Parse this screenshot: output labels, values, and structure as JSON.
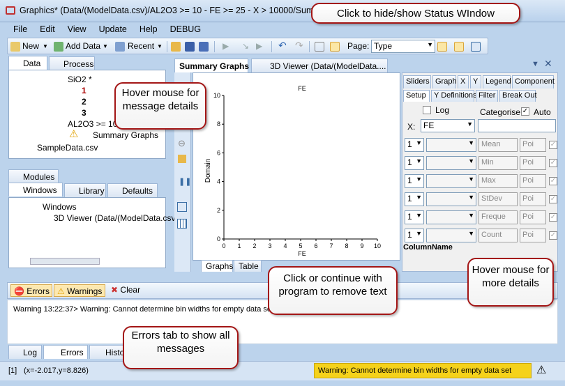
{
  "window": {
    "title": "Graphics* (Data/(ModelData.csv)/AL2O3 >= 10 - FE >= 25 - X > 10000/Summary"
  },
  "menu": [
    "File",
    "Edit",
    "View",
    "Update",
    "Help",
    "DEBUG"
  ],
  "toolbar": {
    "new": "New",
    "add_data": "Add Data",
    "recent": "Recent",
    "page_label": "Page:",
    "page_value": "Type"
  },
  "left_tabs": {
    "data": "Data",
    "process": "Process"
  },
  "data_tree": {
    "sio2": "SiO2 *",
    "n1": "1",
    "n2": "2",
    "n3": "3",
    "al2o3": "AL2O3 >= 10",
    "summary": "Summary Graphs",
    "sample": "SampleData.csv"
  },
  "lower_tabs": {
    "modules": "Modules",
    "windows": "Windows",
    "library": "Library",
    "defaults": "Defaults"
  },
  "windows_tree": {
    "root": "Windows",
    "item": "3D Viewer (Data/(ModelData.csv"
  },
  "doc_tabs": {
    "summary": "Summary Graphs",
    "viewer": "3D Viewer (Data/(ModelData...."
  },
  "chart_data": {
    "type": "bar",
    "title": "FE",
    "xlabel": "FE",
    "ylabel": "Domain",
    "xlim": [
      0,
      10
    ],
    "ylim": [
      0,
      10
    ],
    "xticks": [
      "0",
      "1",
      "2",
      "3",
      "4",
      "5",
      "6",
      "7",
      "8",
      "9",
      "10"
    ],
    "yticks": [
      "0",
      "2",
      "4",
      "6",
      "8",
      "10"
    ],
    "values": []
  },
  "graph_tabs": {
    "graphs": "Graphs",
    "table": "Table"
  },
  "right_tabs": {
    "row1": [
      "Sliders",
      "Graph",
      "X",
      "Y",
      "Legend",
      "Component"
    ],
    "row2": [
      "Setup",
      "Y Definitions",
      "Filter",
      "Break Out"
    ]
  },
  "setup": {
    "log": "Log",
    "categorise": "Categorise:",
    "auto": "Auto",
    "x_label": "X:",
    "x_value": "FE",
    "column_name": "ColumnName",
    "rows": [
      {
        "n": "1",
        "stat": "Mean",
        "p": "Poi"
      },
      {
        "n": "1",
        "stat": "Min",
        "p": "Poi"
      },
      {
        "n": "1",
        "stat": "Max",
        "p": "Poi"
      },
      {
        "n": "1",
        "stat": "StDev",
        "p": "Poi"
      },
      {
        "n": "1",
        "stat": "Freque",
        "p": "Poi"
      },
      {
        "n": "1",
        "stat": "Count",
        "p": "Poi"
      }
    ]
  },
  "messages": {
    "errors": "Errors",
    "warnings": "Warnings",
    "clear": "Clear",
    "line": "Warning 13:22:37> Warning: Cannot determine bin widths for empty data set"
  },
  "bottom_tabs": {
    "log": "Log",
    "errors": "Errors",
    "history": "Histo"
  },
  "status": {
    "page": "[1]",
    "coords": "(x=-2.017,y=8.826)",
    "warning": "Warning: Cannot determine bin widths for empty data set"
  },
  "callouts": {
    "status_window": "Click to hide/show Status WIndow",
    "hover_message": "Hover mouse for message details",
    "remove_text": "Click or continue with program to remove text",
    "more_details": "Hover mouse for more details",
    "errors_tab": "Errors tab to show all messages"
  },
  "colors": {
    "callout_border": "#a31515",
    "status_warning": "#f5d21b",
    "accent": "#3a6ea5"
  }
}
